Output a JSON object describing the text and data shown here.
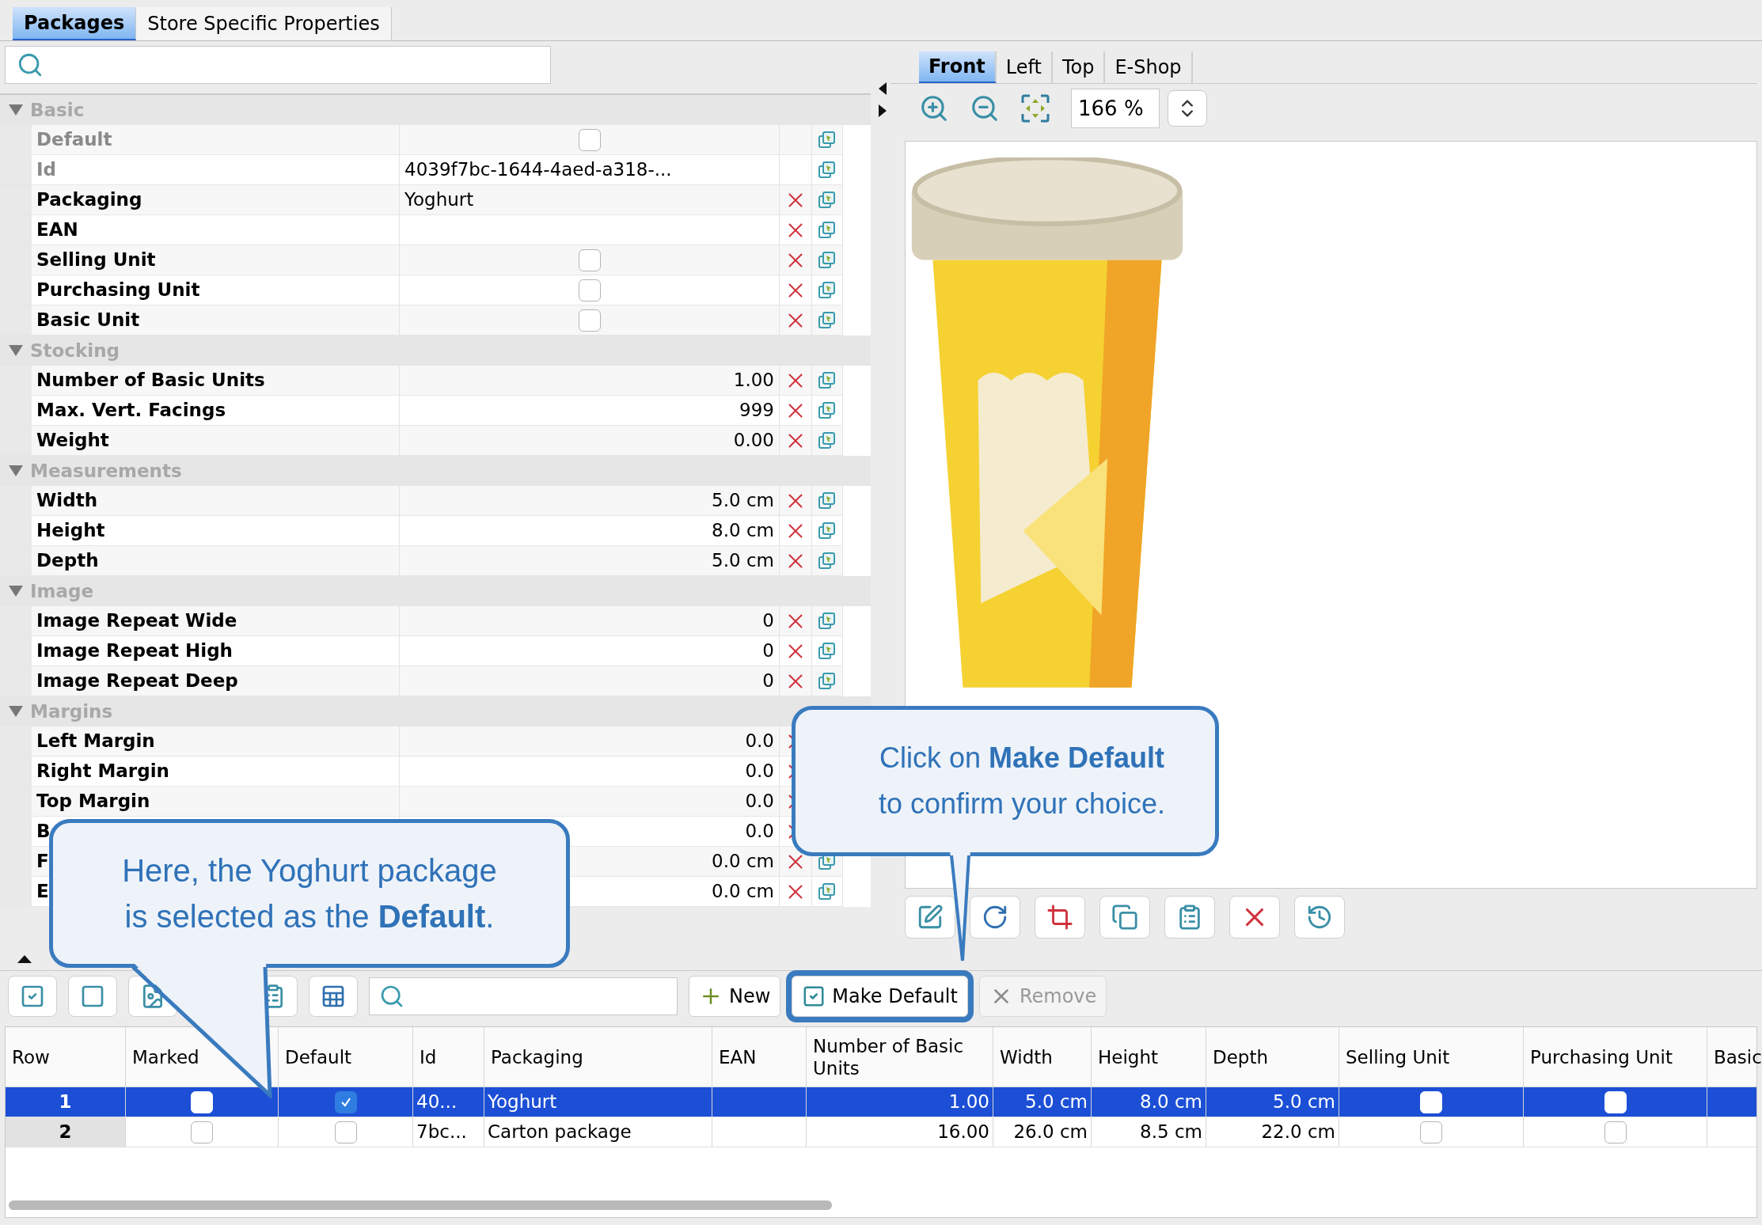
{
  "tabs": [
    {
      "label": "Packages",
      "selected": true
    },
    {
      "label": "Store Specific Properties",
      "selected": false
    }
  ],
  "property_groups": [
    {
      "title": "Basic",
      "expanded": true,
      "rows": [
        {
          "label": "Default",
          "kind": "checkbox",
          "checked": false,
          "read_only": true,
          "removable": false
        },
        {
          "label": "Id",
          "kind": "text",
          "value": "4039f7bc-1644-4aed-a318-...",
          "read_only": true,
          "removable": false
        },
        {
          "label": "Packaging",
          "kind": "text",
          "value": "Yoghurt",
          "read_only": false,
          "removable": true
        },
        {
          "label": "EAN",
          "kind": "text",
          "read_only": false,
          "removable": true
        },
        {
          "label": "Selling Unit",
          "kind": "checkbox",
          "checked": false,
          "read_only": false,
          "removable": true
        },
        {
          "label": "Purchasing Unit",
          "kind": "checkbox",
          "checked": false,
          "read_only": false,
          "removable": true
        },
        {
          "label": "Basic Unit",
          "kind": "checkbox",
          "checked": false,
          "read_only": false,
          "removable": true
        }
      ]
    },
    {
      "title": "Stocking",
      "expanded": true,
      "rows": [
        {
          "label": "Number of Basic Units",
          "kind": "number",
          "value": "1.00",
          "read_only": false,
          "removable": true
        },
        {
          "label": "Max. Vert. Facings",
          "kind": "number",
          "value": "999",
          "read_only": false,
          "removable": true
        },
        {
          "label": "Weight",
          "kind": "number",
          "value": "0.00",
          "read_only": false,
          "removable": true
        }
      ]
    },
    {
      "title": "Measurements",
      "expanded": true,
      "rows": [
        {
          "label": "Width",
          "kind": "number",
          "value": "5.0 cm",
          "read_only": false,
          "removable": true
        },
        {
          "label": "Height",
          "kind": "number",
          "value": "8.0 cm",
          "read_only": false,
          "removable": true
        },
        {
          "label": "Depth",
          "kind": "number",
          "value": "5.0 cm",
          "read_only": false,
          "removable": true
        }
      ]
    },
    {
      "title": "Image",
      "expanded": true,
      "rows": [
        {
          "label": "Image Repeat Wide",
          "kind": "number",
          "value": "0",
          "read_only": false,
          "removable": true
        },
        {
          "label": "Image Repeat High",
          "kind": "number",
          "value": "0",
          "read_only": false,
          "removable": true
        },
        {
          "label": "Image Repeat Deep",
          "kind": "number",
          "value": "0",
          "read_only": false,
          "removable": true
        }
      ]
    },
    {
      "title": "Margins",
      "expanded": true,
      "rows": [
        {
          "label": "Left Margin",
          "kind": "number",
          "value": "0.0",
          "read_only": false,
          "removable": true
        },
        {
          "label": "Right Margin",
          "kind": "number",
          "value": "0.0",
          "read_only": false,
          "removable": true
        },
        {
          "label": "Top Margin",
          "kind": "number",
          "value": "0.0",
          "read_only": false,
          "removable": true
        },
        {
          "label": "B",
          "kind": "number",
          "value": "0.0",
          "read_only": false,
          "removable": true
        },
        {
          "label": "F",
          "kind": "number",
          "value": "0.0 cm",
          "read_only": false,
          "removable": true
        },
        {
          "label": "E",
          "kind": "number",
          "value": "0.0 cm",
          "read_only": false,
          "removable": true
        }
      ]
    }
  ],
  "view_tabs": [
    {
      "label": "Front",
      "selected": true
    },
    {
      "label": "Left",
      "selected": false
    },
    {
      "label": "Top",
      "selected": false
    },
    {
      "label": "E-Shop",
      "selected": false
    }
  ],
  "zoom": {
    "value": "166 %"
  },
  "list_buttons": [
    {
      "label": "New",
      "kind": "add",
      "disabled": false,
      "highlighted": false
    },
    {
      "label": "Make Default",
      "kind": "confirm",
      "disabled": false,
      "highlighted": true
    },
    {
      "label": "Remove",
      "kind": "remove",
      "disabled": true,
      "highlighted": false
    }
  ],
  "table": {
    "columns": [
      "Row",
      "Marked",
      "Default",
      "Id",
      "Packaging",
      "EAN",
      "Number of Basic Units",
      "Width",
      "Height",
      "Depth",
      "Selling Unit",
      "Purchasing Unit",
      "Basic"
    ],
    "rows": [
      {
        "selected": true,
        "cells": [
          {
            "kind": "row_header",
            "text": "1"
          },
          {
            "kind": "checkbox",
            "checked": false
          },
          {
            "kind": "checkbox",
            "checked": true
          },
          {
            "kind": "text",
            "text": "40..."
          },
          {
            "kind": "text",
            "text": "Yoghurt"
          },
          {
            "kind": "text"
          },
          {
            "kind": "number",
            "text": "1.00"
          },
          {
            "kind": "number",
            "text": "5.0 cm"
          },
          {
            "kind": "number",
            "text": "8.0 cm"
          },
          {
            "kind": "number",
            "text": "5.0 cm"
          },
          {
            "kind": "checkbox",
            "checked": false
          },
          {
            "kind": "checkbox",
            "checked": false
          }
        ]
      },
      {
        "selected": false,
        "cells": [
          {
            "kind": "row_header",
            "text": "2"
          },
          {
            "kind": "checkbox",
            "checked": false
          },
          {
            "kind": "checkbox",
            "checked": false
          },
          {
            "kind": "text",
            "text": "7bc..."
          },
          {
            "kind": "text",
            "text": "Carton package"
          },
          {
            "kind": "text"
          },
          {
            "kind": "number",
            "text": "16.00"
          },
          {
            "kind": "number",
            "text": "26.0 cm"
          },
          {
            "kind": "number",
            "text": "8.5 cm"
          },
          {
            "kind": "number",
            "text": "22.0 cm"
          },
          {
            "kind": "checkbox",
            "checked": false
          },
          {
            "kind": "checkbox",
            "checked": false
          }
        ]
      }
    ]
  },
  "callouts": [
    {
      "text": "Here, the Yoghurt package is selected as the **Default**."
    },
    {
      "text": "Click on **Make Default** to confirm your choice."
    }
  ]
}
